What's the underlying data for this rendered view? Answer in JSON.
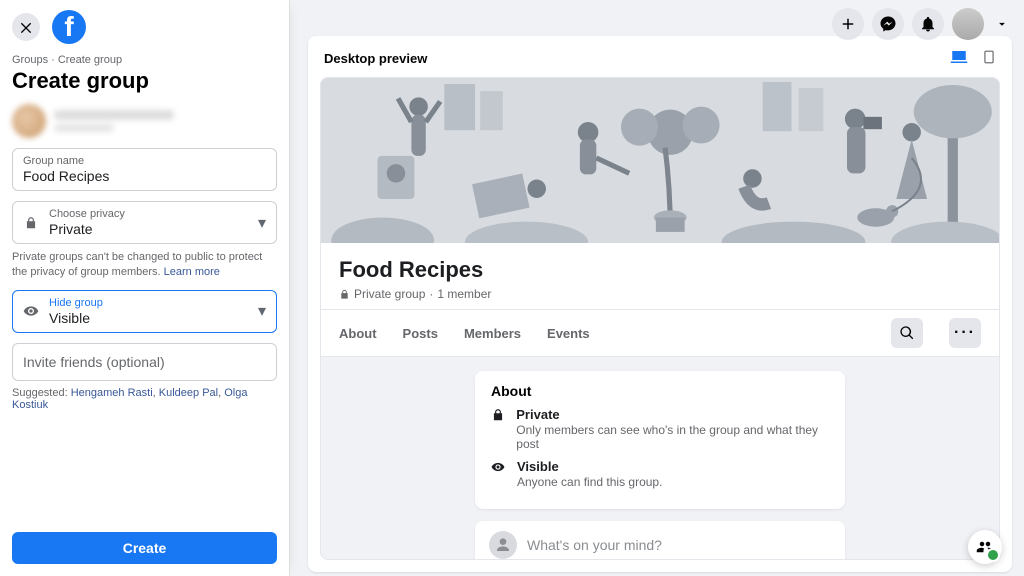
{
  "header": {
    "icons": [
      "plus",
      "messenger",
      "bell"
    ]
  },
  "sidebar": {
    "breadcrumb": {
      "root": "Groups",
      "leaf": "Create group"
    },
    "title": "Create group",
    "group_name": {
      "label": "Group name",
      "value": "Food Recipes"
    },
    "privacy": {
      "label": "Choose privacy",
      "value": "Private"
    },
    "privacy_hint": "Private groups can't be changed to public to protect the privacy of group members.",
    "privacy_learn": "Learn more",
    "visibility": {
      "label": "Hide group",
      "value": "Visible"
    },
    "invite_placeholder": "Invite friends (optional)",
    "suggested_label": "Suggested:",
    "suggested": [
      "Hengameh Rasti",
      "Kuldeep Pal",
      "Olga Kostiuk"
    ],
    "create_label": "Create"
  },
  "preview": {
    "header_label": "Desktop preview",
    "group_title": "Food Recipes",
    "group_meta_privacy": "Private group",
    "group_meta_members": "1 member",
    "tabs": [
      "About",
      "Posts",
      "Members",
      "Events"
    ],
    "about": {
      "heading": "About",
      "private_title": "Private",
      "private_desc": "Only members can see who's in the group and what they post",
      "visible_title": "Visible",
      "visible_desc": "Anyone can find this group."
    },
    "composer_prompt": "What's on your mind?"
  }
}
